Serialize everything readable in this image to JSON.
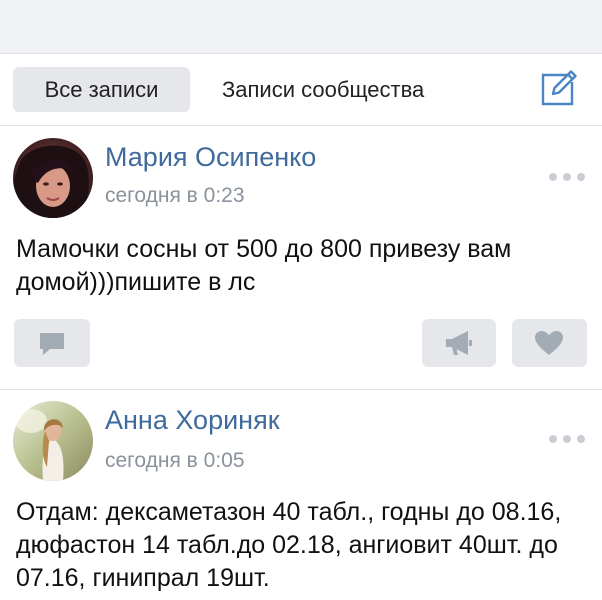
{
  "filters": {
    "all_posts_label": "Все записи",
    "community_posts_label": "Записи сообщества"
  },
  "posts": [
    {
      "author": "Мария Осипенко",
      "time": "сегодня в 0:23",
      "text": "Мамочки сосны от 500 до 800 привезу вам домой)))пишите в лс"
    },
    {
      "author": "Анна Хориняк",
      "time": "сегодня в 0:05",
      "text": "Отдам: дексаметазон 40 табл., годны до 08.16, дюфастон 14 табл.до 02.18, ангиовит 40шт. до 07.16, гинипрал 19шт."
    }
  ],
  "icons": {
    "edit": "compose-icon",
    "more": "more-dots-icon",
    "comment": "comment-icon",
    "share": "megaphone-icon",
    "like": "heart-icon"
  },
  "colors": {
    "author_link": "#3f6a9c",
    "accent_icon": "#4a86c5",
    "meta_gray": "#8a929c",
    "button_bg": "#e5e7ea",
    "button_icon": "#a3abb5"
  }
}
